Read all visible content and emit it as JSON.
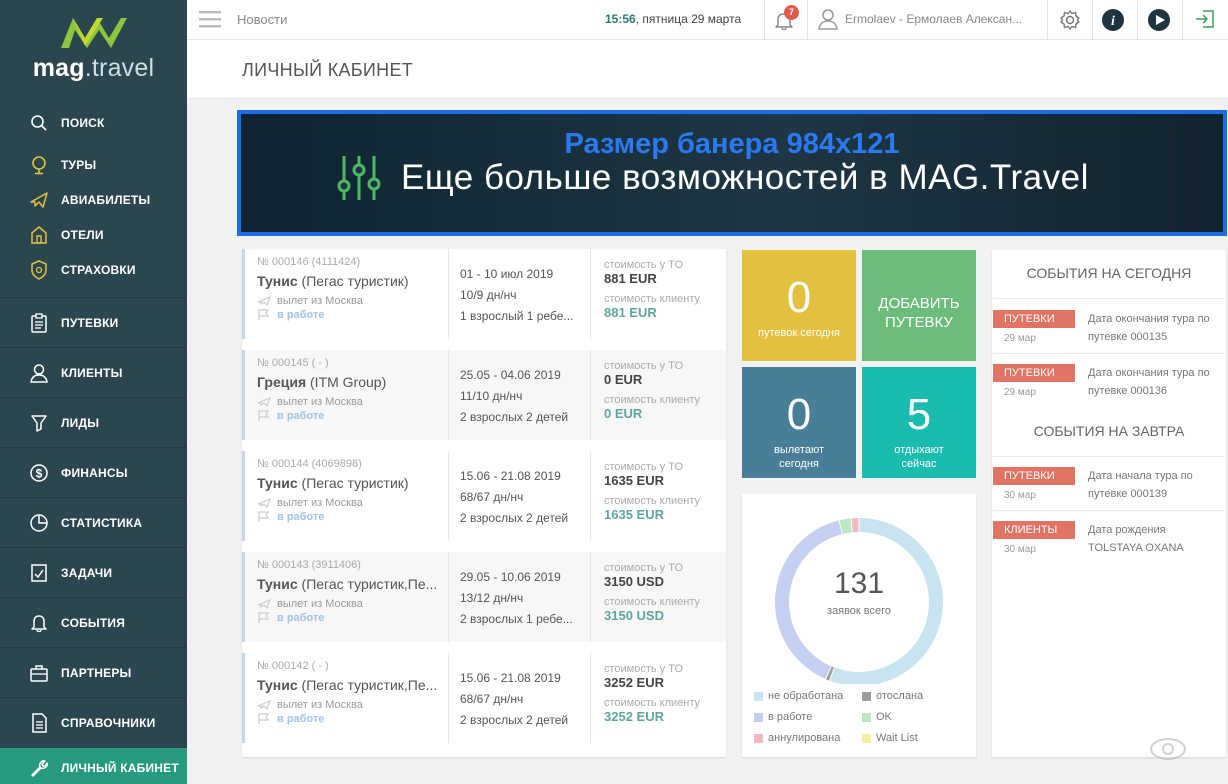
{
  "sidebar": {
    "logo_main": "mag",
    "logo_suffix": ".travel",
    "items": [
      {
        "label": "ПОИСК",
        "icon": "search-icon"
      },
      {
        "label": "ТУРЫ",
        "icon": "globe-icon"
      },
      {
        "label": "АВИАБИЛЕТЫ",
        "icon": "plane-icon"
      },
      {
        "label": "ОТЕЛИ",
        "icon": "hotel-icon"
      },
      {
        "label": "СТРАХОВКИ",
        "icon": "shield-icon"
      },
      {
        "label": "ПУТЕВКИ",
        "icon": "clipboard-icon"
      },
      {
        "label": "КЛИЕНТЫ",
        "icon": "user-icon"
      },
      {
        "label": "ЛИДЫ",
        "icon": "funnel-icon"
      },
      {
        "label": "ФИНАНСЫ",
        "icon": "dollar-icon"
      },
      {
        "label": "СТАТИСТИКА",
        "icon": "pie-chart-icon"
      },
      {
        "label": "ЗАДАЧИ",
        "icon": "task-icon"
      },
      {
        "label": "СОБЫТИЯ",
        "icon": "bell-icon"
      },
      {
        "label": "ПАРТНЕРЫ",
        "icon": "briefcase-icon"
      },
      {
        "label": "СПРАВОЧНИКИ",
        "icon": "document-icon"
      },
      {
        "label": "ЛИЧНЫЙ КАБИНЕТ",
        "icon": "wrench-icon"
      }
    ]
  },
  "topbar": {
    "news_label": "Новости",
    "time": "15:56",
    "date": ", пятница 29 марта",
    "notifications_count": "7",
    "user_name": "Ermolaev - Ермолаев Алексан..."
  },
  "page_title": "ЛИЧНЫЙ КАБИНЕТ",
  "banner": {
    "size_text": "Размер банера  984x121",
    "slogan": "Еще больше возможностей в MAG.Travel"
  },
  "trips": [
    {
      "number": "№ 000146 (4111424)",
      "country": "Тунис",
      "operator": " (Пегас туристик)",
      "departure": "вылет из Москва",
      "status": "в работе",
      "dates": "01 - 10 июл 2019",
      "nights": "10/9 дн/нч",
      "people": "1 взрослый 1 ребе...",
      "cost_to_label": "стоимость у ТО",
      "cost_to": "881 EUR",
      "cost_client_label": "стоимость клиенту",
      "cost_client": "881 EUR"
    },
    {
      "number": "№ 000145 ( - )",
      "country": "Греция",
      "operator": " (ITM Group)",
      "departure": "вылет из Москва",
      "status": "в работе",
      "dates": "25.05 - 04.06 2019",
      "nights": "11/10 дн/нч",
      "people": "2 взрослых 2 детей",
      "cost_to_label": "стоимость у ТО",
      "cost_to": "0 EUR",
      "cost_client_label": "стоимость клиенту",
      "cost_client": "0 EUR"
    },
    {
      "number": "№ 000144 (4069898)",
      "country": "Тунис",
      "operator": " (Пегас туристик)",
      "departure": "вылет из Москва",
      "status": "в работе",
      "dates": "15.06 - 21.08 2019",
      "nights": "68/67 дн/нч",
      "people": "2 взрослых 2 детей",
      "cost_to_label": "стоимость у ТО",
      "cost_to": "1635 EUR",
      "cost_client_label": "стоимость клиенту",
      "cost_client": "1635 EUR"
    },
    {
      "number": "№ 000143 (3911406)",
      "country": "Тунис",
      "operator": " (Пегас туристик,Пе...",
      "departure": "вылет из Москва",
      "status": "в работе",
      "dates": "29.05 - 10.06 2019",
      "nights": "13/12 дн/нч",
      "people": "2 взрослых 1 ребе...",
      "cost_to_label": "стоимость у ТО",
      "cost_to": "3150 USD",
      "cost_client_label": "стоимость клиенту",
      "cost_client": "3150 USD"
    },
    {
      "number": "№ 000142 ( - )",
      "country": "Тунис",
      "operator": " (Пегас туристик,Пе...",
      "departure": "вылет из Москва",
      "status": "в работе",
      "dates": "15.06 - 21.08 2019",
      "nights": "68/67 дн/нч",
      "people": "2 взрослых 2 детей",
      "cost_to_label": "стоимость у ТО",
      "cost_to": "3252 EUR",
      "cost_client_label": "стоимость клиенту",
      "cost_client": "3252 EUR"
    }
  ],
  "tiles": {
    "today": {
      "value": "0",
      "label": "путевок сегодня",
      "color": "#e3c13f"
    },
    "add": {
      "label1": "ДОБАВИТЬ",
      "label2": "ПУТЕВКУ",
      "color": "#6cbc7c"
    },
    "departing": {
      "value": "0",
      "label1": "вылетают",
      "label2": "сегодня",
      "color": "#497e98"
    },
    "resting": {
      "value": "5",
      "label1": "отдыхают",
      "label2": "сейчас",
      "color": "#1abcaf"
    }
  },
  "chart_data": {
    "type": "pie",
    "center_value": "131",
    "center_label": "заявок всего",
    "slices": [
      {
        "name": "не обработана",
        "value": 73,
        "color": "#c8e4f1"
      },
      {
        "name": "отослана",
        "value": 1,
        "color": "#9e9e9e"
      },
      {
        "name": "в работе",
        "value": 52,
        "color": "#c4cff2"
      },
      {
        "name": "OK",
        "value": 3,
        "color": "#b9e8c2"
      },
      {
        "name": "аннулирована",
        "value": 2,
        "color": "#f3b8c3"
      },
      {
        "name": "Wait List",
        "value": 0,
        "color": "#f4f19c"
      }
    ]
  },
  "events": {
    "today_title": "СОБЫТИЯ НА СЕГОДНЯ",
    "tomorrow_title": "СОБЫТИЯ НА ЗАВТРА",
    "today": [
      {
        "tag": "ПУТЕВКИ",
        "date": "29 мар",
        "text": "Дата окончания тура по путевке 000135"
      },
      {
        "tag": "ПУТЕВКИ",
        "date": "29 мар",
        "text": "Дата окончания тура по путевке 000136"
      }
    ],
    "tomorrow": [
      {
        "tag": "ПУТЕВКИ",
        "date": "30 мар",
        "text": "Дата начала тура по путевке 000139"
      },
      {
        "tag": "КЛИЕНТЫ",
        "date": "30 мар",
        "text": "Дата рождения TOLSTAYA OXANA"
      }
    ]
  }
}
